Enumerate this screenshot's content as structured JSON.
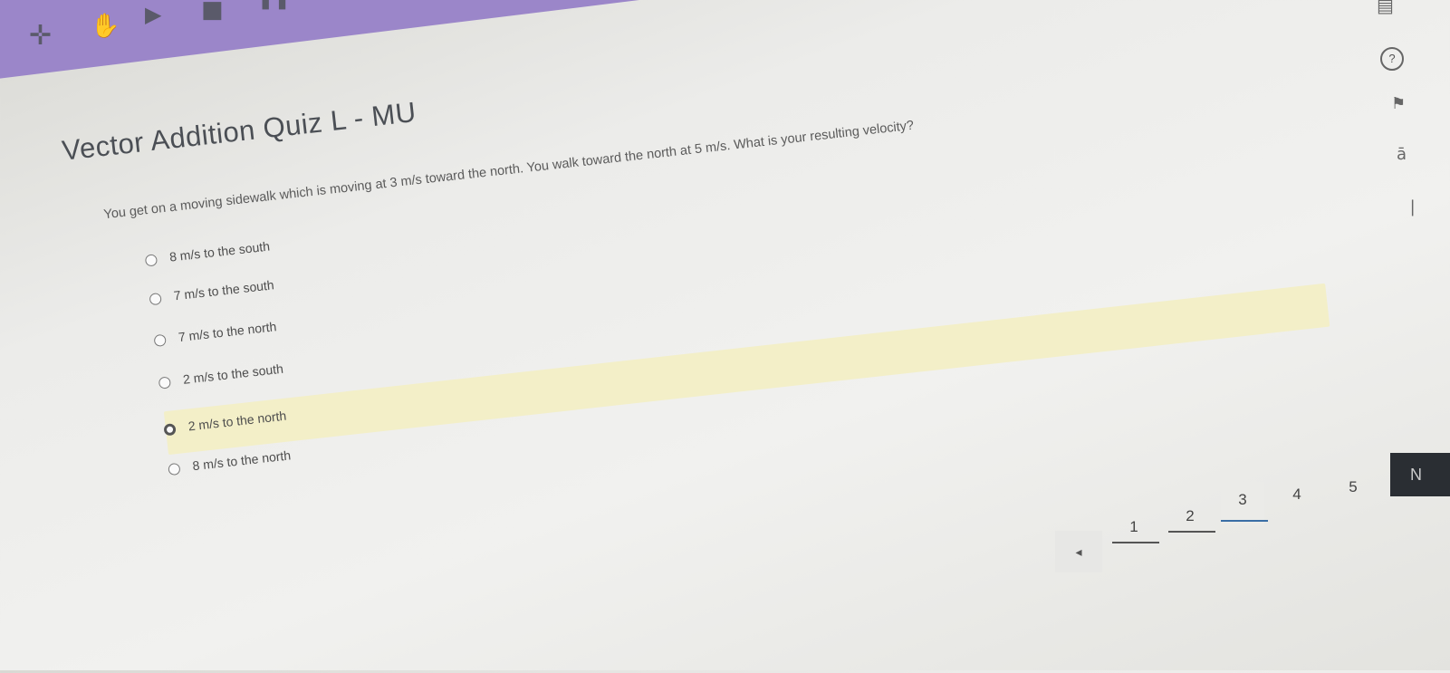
{
  "quiz": {
    "title": "Vector Addition Quiz L - MU",
    "question": "You get on a moving sidewalk which is moving at 3 m/s toward the north.  You walk toward the north at 5 m/s.  What is your resulting velocity?",
    "options": [
      {
        "label": "8 m/s to the south",
        "selected": false
      },
      {
        "label": "7 m/s to the south",
        "selected": false
      },
      {
        "label": "7 m/s to the north",
        "selected": false
      },
      {
        "label": "2 m/s to the south",
        "selected": false
      },
      {
        "label": "2 m/s to the north",
        "selected": true
      },
      {
        "label": "8 m/s to the north",
        "selected": false
      }
    ]
  },
  "pager": {
    "prev_icon": "◂",
    "pages": [
      "1",
      "2",
      "3",
      "4",
      "5"
    ],
    "current": "3",
    "next_label": "N"
  },
  "colors": {
    "toolbar": "#9b86c9",
    "highlight": "#f3efc8",
    "accent": "#3a6ea5"
  },
  "icons": {
    "toolbar": [
      "crosshair-icon",
      "hand-icon",
      "play-icon",
      "stop-icon",
      "pause-icon"
    ],
    "side": [
      "help-icon",
      "flag-icon",
      "text-icon",
      "bookmark-icon"
    ]
  }
}
